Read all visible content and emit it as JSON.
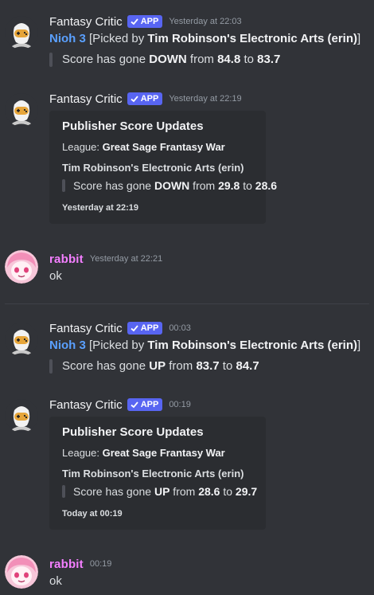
{
  "app_badge": "APP",
  "messages": [
    {
      "author": "Fantasy Critic",
      "timestamp": "Yesterday at 22:03",
      "game": "Nioh 3",
      "picked_prefix": "[Picked by ",
      "picked_by": "Tim Robinson's Electronic Arts (erin)",
      "picked_suffix": "]",
      "q_prefix": "Score has gone ",
      "q_dir": "DOWN",
      "q_from": " from ",
      "q_old": "84.8",
      "q_to": " to ",
      "q_new": "83.7"
    },
    {
      "author": "Fantasy Critic",
      "timestamp": "Yesterday at 22:19",
      "embed": {
        "title": "Publisher Score Updates",
        "league_label": "League: ",
        "league": "Great Sage Frantasy War",
        "publisher": "Tim Robinson's Electronic Arts (erin)",
        "q_prefix": "Score has gone ",
        "q_dir": "DOWN",
        "q_from": " from ",
        "q_old": "29.8",
        "q_to": " to ",
        "q_new": "28.6",
        "footer": "Yesterday at 22:19"
      }
    },
    {
      "author": "rabbit",
      "timestamp": "Yesterday at 22:21",
      "text": "ok"
    },
    {
      "author": "Fantasy Critic",
      "timestamp": "00:03",
      "game": "Nioh 3",
      "picked_prefix": "[Picked by ",
      "picked_by": "Tim Robinson's Electronic Arts (erin)",
      "picked_suffix": "]",
      "q_prefix": "Score has gone ",
      "q_dir": "UP",
      "q_from": " from ",
      "q_old": "83.7",
      "q_to": " to ",
      "q_new": "84.7"
    },
    {
      "author": "Fantasy Critic",
      "timestamp": "00:19",
      "embed": {
        "title": "Publisher Score Updates",
        "league_label": "League: ",
        "league": "Great Sage Frantasy War",
        "publisher": "Tim Robinson's Electronic Arts (erin)",
        "q_prefix": "Score has gone ",
        "q_dir": "UP",
        "q_from": " from ",
        "q_old": "28.6",
        "q_to": " to ",
        "q_new": "29.7",
        "footer": "Today at 00:19"
      }
    },
    {
      "author": "rabbit",
      "timestamp": "00:19",
      "text": "ok"
    }
  ],
  "colors": {
    "background": "#313338",
    "embed_bg": "#2b2d31",
    "app_badge": "#5865f2",
    "game_link": "#5aa0ff",
    "rabbit_name": "#f47fff"
  },
  "icons": [
    "fantasy-critic-avatar-icon",
    "rabbit-avatar-icon",
    "checkmark-icon"
  ]
}
